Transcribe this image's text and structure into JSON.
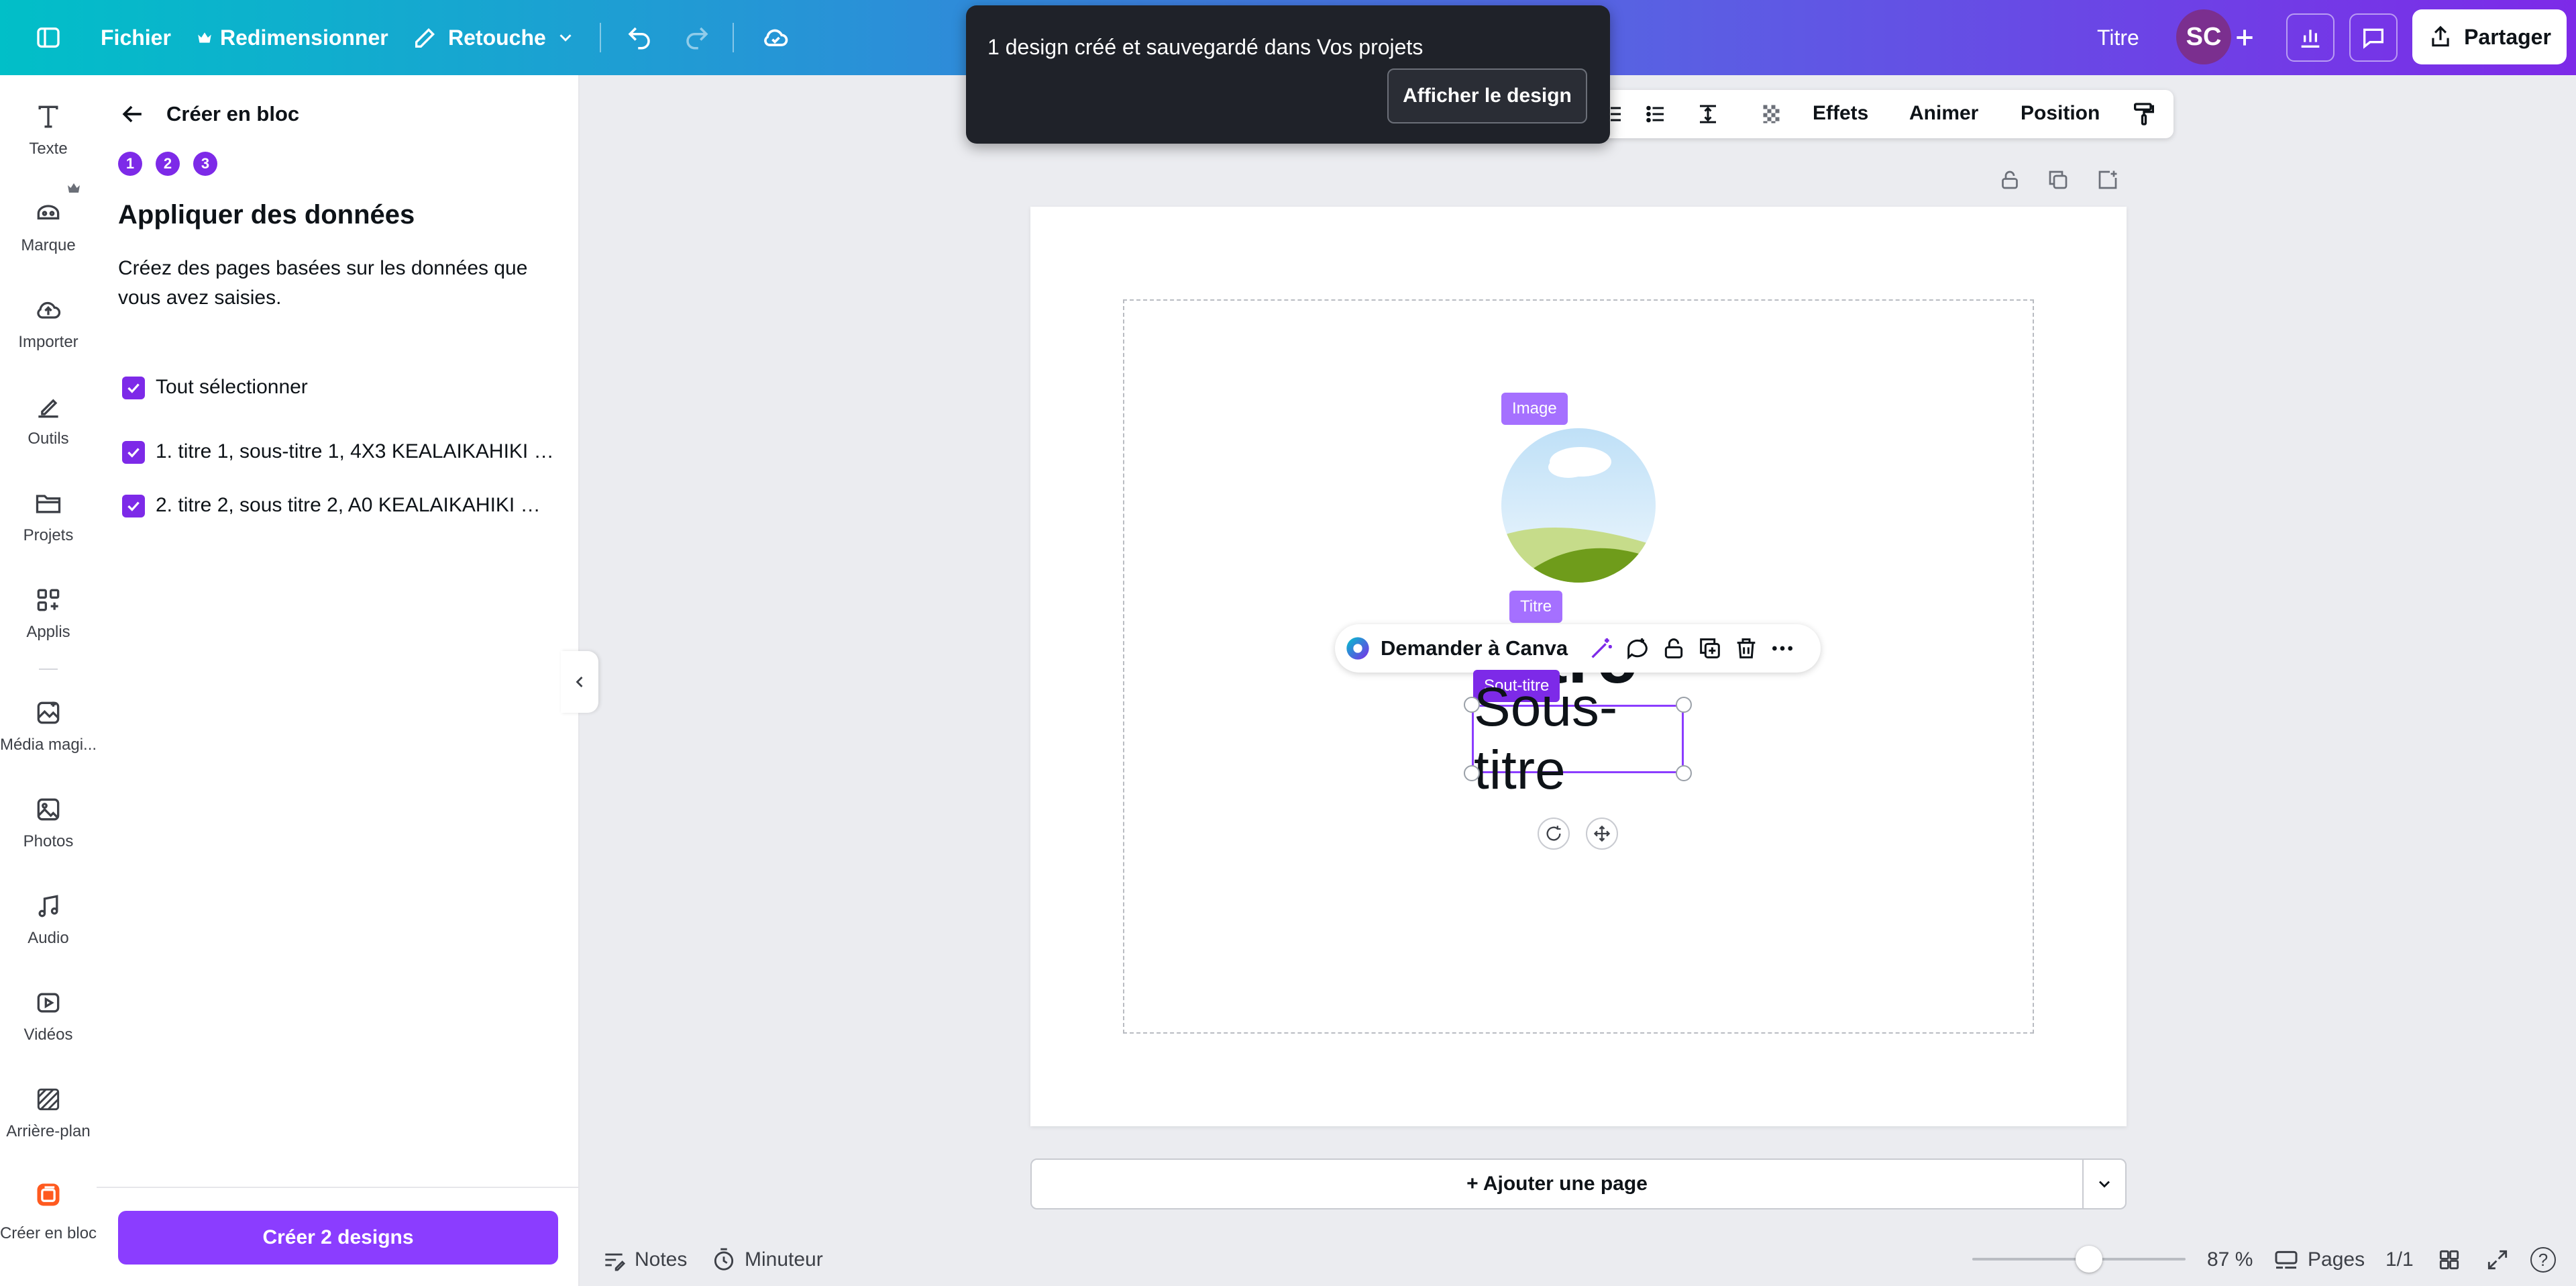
{
  "topbar": {
    "file_label": "Fichier",
    "resize_label": "Redimensionner",
    "edit_label": "Retouche",
    "title_label": "Titre",
    "avatar_initials": "SC",
    "share_label": "Partager"
  },
  "toast": {
    "message": "1 design créé et sauvegardé dans Vos projets",
    "action_label": "Afficher le design"
  },
  "context_toolbar": {
    "effects_label": "Effets",
    "animate_label": "Animer",
    "position_label": "Position"
  },
  "rail": {
    "items": [
      {
        "label": "Texte",
        "icon": "text-icon"
      },
      {
        "label": "Marque",
        "icon": "brand-icon"
      },
      {
        "label": "Importer",
        "icon": "upload-icon"
      },
      {
        "label": "Outils",
        "icon": "tools-icon"
      },
      {
        "label": "Projets",
        "icon": "folder-icon"
      },
      {
        "label": "Applis",
        "icon": "apps-icon"
      },
      {
        "label": "Média magi...",
        "icon": "magic-media-icon"
      },
      {
        "label": "Photos",
        "icon": "photos-icon"
      },
      {
        "label": "Audio",
        "icon": "audio-icon"
      },
      {
        "label": "Vidéos",
        "icon": "videos-icon"
      },
      {
        "label": "Arrière-plan",
        "icon": "background-icon"
      },
      {
        "label": "Créer en bloc",
        "icon": "bulk-create-icon"
      }
    ]
  },
  "panel": {
    "back_title": "Créer en bloc",
    "steps": [
      "1",
      "2",
      "3"
    ],
    "heading": "Appliquer des données",
    "description_line1": "Créez des pages basées sur les données que",
    "description_line2": "vous avez saisies.",
    "select_all_label": "Tout sélectionner",
    "rows": [
      "1. titre 1, sous-titre 1, 4X3 KEALAIKAHIKI H...",
      "2. titre 2, sous titre 2, A0 KEALAIKAHIKI HO..."
    ],
    "create_button_label": "Créer 2 designs"
  },
  "canvas": {
    "tag_image": "Image",
    "tag_title": "Titre",
    "tag_subtitle": "Sout-titre",
    "title_fragment": "tre",
    "subtitle_text": "Sous-titre",
    "ask_canva_label": "Demander à Canva",
    "add_page_label": "+ Ajouter une page"
  },
  "bottom": {
    "notes_label": "Notes",
    "timer_label": "Minuteur",
    "zoom_label": "87 %",
    "zoom_value": 87,
    "pages_label": "Pages",
    "page_counter": "1/1",
    "help_label": "?"
  },
  "colors": {
    "accent": "#8b3dff",
    "accent_dark": "#7d2ae8",
    "toast_bg": "#1f2229",
    "topbar_start": "#01bfc8",
    "topbar_end": "#7d2ae8"
  }
}
